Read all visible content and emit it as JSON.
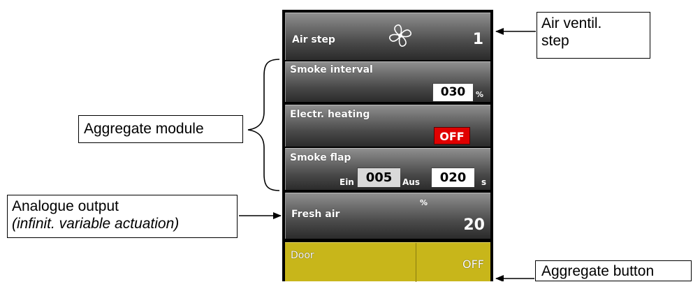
{
  "panel": {
    "air_step": {
      "label": "Air step",
      "value": "1"
    },
    "smoke_interval": {
      "label": "Smoke interval",
      "value": "030",
      "unit": "%"
    },
    "electr_heating": {
      "label": "Electr. heating",
      "value": "OFF"
    },
    "smoke_flap": {
      "label": "Smoke flap",
      "on_label": "Ein",
      "on_value": "005",
      "off_label": "Aus",
      "off_value": "020",
      "unit": "s"
    },
    "fresh_air": {
      "label": "Fresh air",
      "unit": "%",
      "value": "20"
    },
    "door": {
      "label": "Door",
      "value": "OFF"
    }
  },
  "callouts": {
    "air_ventil_line1": "Air ventil.",
    "air_ventil_line2": "step",
    "aggregate_module": "Aggregate module",
    "analogue_line1": "Analogue output",
    "analogue_line2": "(infinit. variable actuation)",
    "aggregate_button": "Aggregate button"
  },
  "colors": {
    "tile_dark": "#2b2b2b",
    "tile_light": "#8f8f8f",
    "off_red": "#e00000",
    "door_yellow": "#c8b61a"
  }
}
